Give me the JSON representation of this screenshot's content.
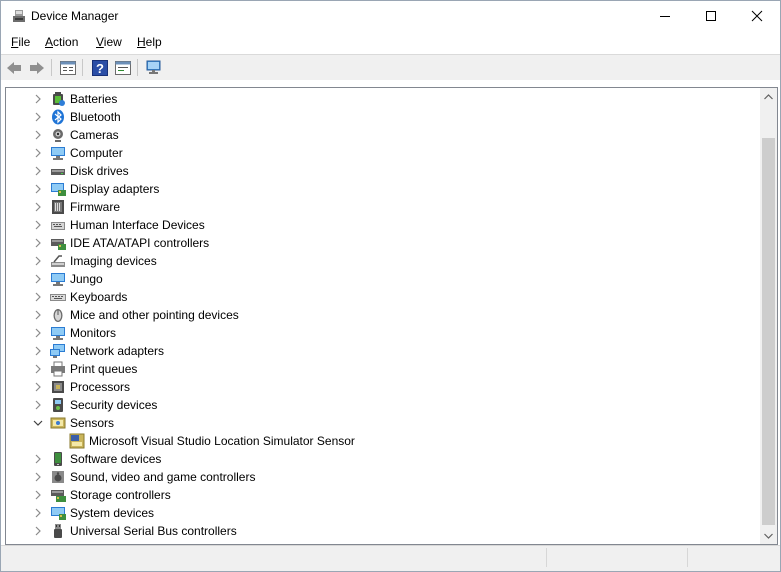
{
  "window": {
    "title": "Device Manager"
  },
  "menu": [
    {
      "label": "File",
      "accel": "F",
      "rest": "ile"
    },
    {
      "label": "Action",
      "accel": "A",
      "rest": "ction"
    },
    {
      "label": "View",
      "accel": "V",
      "rest": "iew"
    },
    {
      "label": "Help",
      "accel": "H",
      "rest": "elp"
    }
  ],
  "toolbar": [
    "back-icon",
    "forward-icon",
    "properties-icon",
    "help-icon",
    "update-driver-icon",
    "scan-hardware-icon"
  ],
  "tree": [
    {
      "label": "Batteries",
      "icon": "battery-icon",
      "expanded": false,
      "level": 0
    },
    {
      "label": "Bluetooth",
      "icon": "bluetooth-icon",
      "expanded": false,
      "level": 0
    },
    {
      "label": "Cameras",
      "icon": "camera-icon",
      "expanded": false,
      "level": 0
    },
    {
      "label": "Computer",
      "icon": "computer-icon",
      "expanded": false,
      "level": 0
    },
    {
      "label": "Disk drives",
      "icon": "disk-drive-icon",
      "expanded": false,
      "level": 0
    },
    {
      "label": "Display adapters",
      "icon": "display-adapter-icon",
      "expanded": false,
      "level": 0
    },
    {
      "label": "Firmware",
      "icon": "firmware-icon",
      "expanded": false,
      "level": 0
    },
    {
      "label": "Human Interface Devices",
      "icon": "hid-icon",
      "expanded": false,
      "level": 0
    },
    {
      "label": "IDE ATA/ATAPI controllers",
      "icon": "ide-controller-icon",
      "expanded": false,
      "level": 0
    },
    {
      "label": "Imaging devices",
      "icon": "imaging-device-icon",
      "expanded": false,
      "level": 0
    },
    {
      "label": "Jungo",
      "icon": "jungo-icon",
      "expanded": false,
      "level": 0
    },
    {
      "label": "Keyboards",
      "icon": "keyboard-icon",
      "expanded": false,
      "level": 0
    },
    {
      "label": "Mice and other pointing devices",
      "icon": "mouse-icon",
      "expanded": false,
      "level": 0
    },
    {
      "label": "Monitors",
      "icon": "monitor-icon",
      "expanded": false,
      "level": 0
    },
    {
      "label": "Network adapters",
      "icon": "network-adapter-icon",
      "expanded": false,
      "level": 0
    },
    {
      "label": "Print queues",
      "icon": "printer-icon",
      "expanded": false,
      "level": 0
    },
    {
      "label": "Processors",
      "icon": "processor-icon",
      "expanded": false,
      "level": 0
    },
    {
      "label": "Security devices",
      "icon": "security-device-icon",
      "expanded": false,
      "level": 0
    },
    {
      "label": "Sensors",
      "icon": "sensor-icon",
      "expanded": true,
      "level": 0
    },
    {
      "label": "Microsoft Visual Studio Location Simulator Sensor",
      "icon": "sensor-device-icon",
      "level": 1
    },
    {
      "label": "Software devices",
      "icon": "software-device-icon",
      "expanded": false,
      "level": 0
    },
    {
      "label": "Sound, video and game controllers",
      "icon": "speaker-icon",
      "expanded": false,
      "level": 0
    },
    {
      "label": "Storage controllers",
      "icon": "storage-controller-icon",
      "expanded": false,
      "level": 0
    },
    {
      "label": "System devices",
      "icon": "system-device-icon",
      "expanded": false,
      "level": 0
    },
    {
      "label": "Universal Serial Bus controllers",
      "icon": "usb-icon",
      "expanded": false,
      "level": 0
    }
  ]
}
